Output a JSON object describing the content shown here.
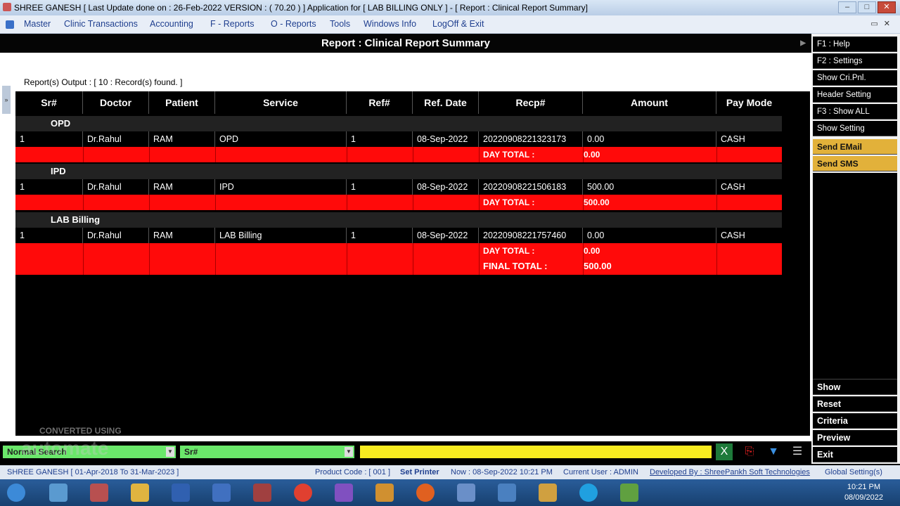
{
  "window": {
    "title": "SHREE GANESH [ Last Update done on : 26-Feb-2022 VERSION : ( 70.20 ) ] Application for [ LAB BILLING ONLY ] - [ Report : Clinical Report Summary]"
  },
  "menu": {
    "items": [
      "Master",
      "Clinic Transactions",
      "Accounting",
      "F - Reports",
      "O - Reports",
      "Tools",
      "Windows Info",
      "LogOff & Exit"
    ]
  },
  "report": {
    "title": "Report : Clinical Report Summary",
    "output_label": "Report(s) Output :  [ 10 : Record(s) found. ]"
  },
  "table": {
    "columns": [
      "Sr#",
      "Doctor",
      "Patient",
      "Service",
      "Ref#",
      "Ref. Date",
      "Recp#",
      "Amount",
      "Pay Mode"
    ],
    "groups": [
      {
        "name": "OPD",
        "row": {
          "sr": "1",
          "doctor": "Dr.Rahul",
          "patient": "RAM",
          "service": "OPD",
          "ref": "1",
          "ref_date": "08-Sep-2022",
          "recp": "20220908221323173",
          "amount": "0.00",
          "pay_mode": "CASH"
        },
        "day_total_label": "DAY TOTAL :",
        "day_total": "0.00"
      },
      {
        "name": "IPD",
        "row": {
          "sr": "1",
          "doctor": "Dr.Rahul",
          "patient": "RAM",
          "service": "IPD",
          "ref": "1",
          "ref_date": "08-Sep-2022",
          "recp": "20220908221506183",
          "amount": "500.00",
          "pay_mode": "CASH"
        },
        "day_total_label": "DAY TOTAL :",
        "day_total": "500.00"
      },
      {
        "name": "LAB Billing",
        "row": {
          "sr": "1",
          "doctor": "Dr.Rahul",
          "patient": "RAM",
          "service": "LAB Billing",
          "ref": "1",
          "ref_date": "08-Sep-2022",
          "recp": "20220908221757460",
          "amount": "0.00",
          "pay_mode": "CASH"
        },
        "day_total_label": "DAY TOTAL :",
        "day_total": "0.00"
      }
    ],
    "final_total_label": "FINAL TOTAL :",
    "final_total": "500.00"
  },
  "right_panel": {
    "top_buttons": [
      "F1 : Help",
      "F2 : Settings",
      "Show Cri.Pnl.",
      "Header Setting",
      "F3 : Show ALL",
      "Show Setting"
    ],
    "send_email": "Send EMail",
    "send_sms": "Send SMS",
    "bottom_buttons": [
      "Show",
      "Reset",
      "Criteria",
      "Preview",
      "Exit"
    ]
  },
  "search": {
    "mode": "Normal Search",
    "field": "Sr#",
    "value": ""
  },
  "statusbar": {
    "company": "SHREE GANESH   [ 01-Apr-2018 To 31-Mar-2023 ]",
    "product_code": "Product Code : [ 001 ]",
    "set_printer": "Set Printer",
    "now": "Now : 08-Sep-2022 10:21 PM",
    "current_user": "Current User : ADMIN",
    "developed_by": "Developed By : ShreePankh Soft Technologies",
    "global_setting": "Global Setting(s)"
  },
  "taskbar": {
    "time": "10:21 PM",
    "date": "08/09/2022"
  },
  "watermark": {
    "line1": "CONVERTED USING",
    "line2": "automate"
  }
}
